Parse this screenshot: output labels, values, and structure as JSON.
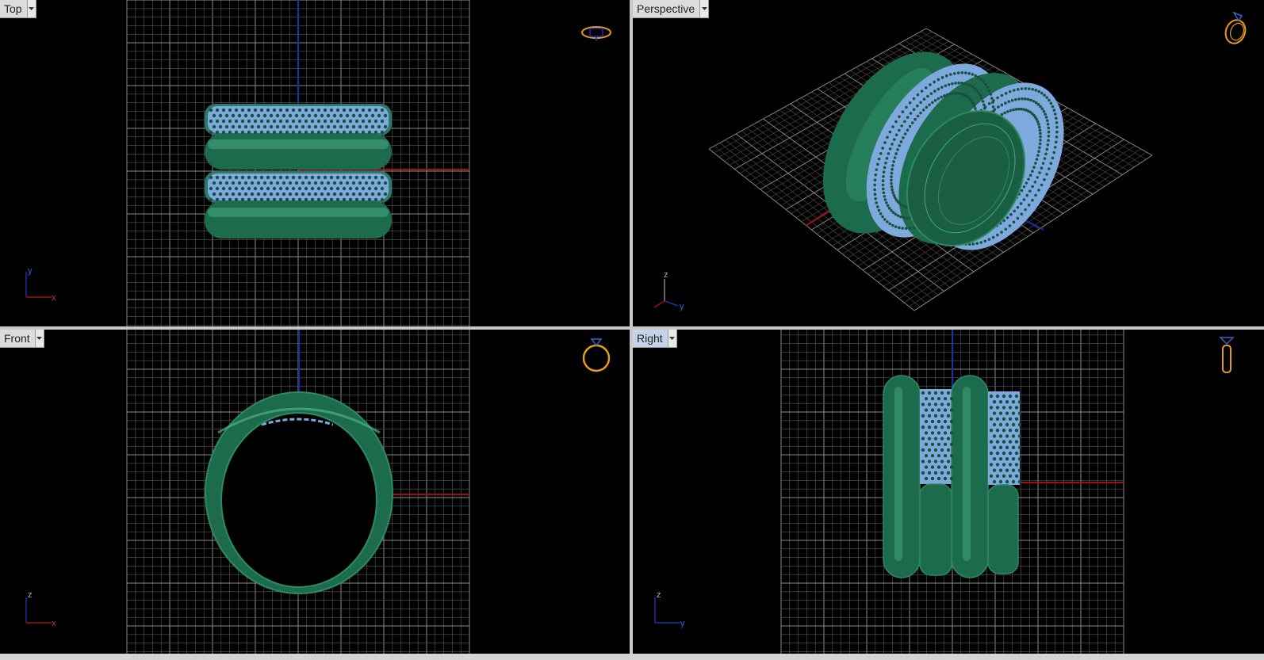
{
  "viewports": [
    {
      "id": "top",
      "title": "Top",
      "axes": [
        "y",
        "x"
      ],
      "view_icon": "ring-top-view-icon"
    },
    {
      "id": "perspective",
      "title": "Perspective",
      "axes": [
        "z",
        "y"
      ],
      "view_icon": "ring-perspective-view-icon"
    },
    {
      "id": "front",
      "title": "Front",
      "axes": [
        "z",
        "x"
      ],
      "view_icon": "ring-front-view-icon"
    },
    {
      "id": "right",
      "title": "Right",
      "axes": [
        "z",
        "y"
      ],
      "view_icon": "ring-right-view-icon"
    }
  ],
  "active_viewport": "right",
  "colors": {
    "background": "#000000",
    "grid": "#5a5a5a",
    "grid_major": "#8a8a8a",
    "x_axis": "#a01010",
    "y_axis": "#1c2fa8",
    "metal": "#1d6b4d",
    "gem": "#8cb8ee",
    "icon_orange": "#e69a1e"
  }
}
